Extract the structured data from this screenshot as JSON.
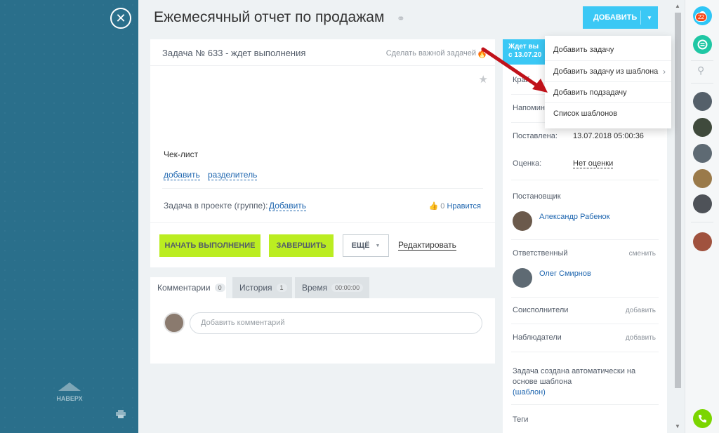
{
  "left": {
    "close_glyph": "✕",
    "up_label": "НАВЕРХ"
  },
  "header": {
    "title": "Ежемесячный отчет по продажам",
    "add_button": "ДОБАВИТЬ"
  },
  "dropdown": {
    "items": [
      {
        "label": "Добавить задачу"
      },
      {
        "label": "Добавить задачу из шаблона"
      },
      {
        "label": "Добавить подзадачу"
      },
      {
        "label": "Список шаблонов"
      }
    ]
  },
  "task": {
    "number_status": "Задача № 633 - ждет выполнения",
    "make_important": "Сделать важной задачей",
    "checklist_title": "Чек-лист",
    "checklist_add": "добавить",
    "checklist_separator": "разделитель",
    "project_label": "Задача в проекте (группе):",
    "project_add": "Добавить",
    "likes_count": "0",
    "like_label": "Нравится",
    "btn_start": "НАЧАТЬ ВЫПОЛНЕНИЕ",
    "btn_finish": "ЗАВЕРШИТЬ",
    "btn_more": "ЕЩЁ",
    "edit_link": "Редактировать"
  },
  "tabs": [
    {
      "label": "Комментарии",
      "count": "0"
    },
    {
      "label": "История",
      "count": "1"
    },
    {
      "label": "Время",
      "count": "00:00:00"
    }
  ],
  "comments": {
    "placeholder": "Добавить комментарий"
  },
  "info": {
    "status_line1": "Ждет вы",
    "status_line2": "с 13.07.20",
    "deadline_label": "Край",
    "remind_label": "Напомина",
    "created_label": "Поставлена:",
    "created_value": "13.07.2018 05:00:36",
    "rating_label": "Оценка:",
    "rating_value": "Нет оценки",
    "creator_label": "Постановщик",
    "creator_name": "Александр Рабенок",
    "responsible_label": "Ответственный",
    "responsible_change": "сменить",
    "responsible_name": "Олег Смирнов",
    "coexec_label": "Соисполнители",
    "coexec_add": "добавить",
    "observers_label": "Наблюдатели",
    "observers_add": "добавить",
    "auto_text": "Задача создана автоматически на основе шаблона",
    "template_link": "(шаблон)",
    "tags_label": "Теги"
  },
  "right_bar": {
    "notifications_count": "22"
  },
  "colors": {
    "accent": "#3bc8f5",
    "green": "#bbed21",
    "sidebar": "#2a6f8b",
    "arrow": "#c0121a"
  }
}
